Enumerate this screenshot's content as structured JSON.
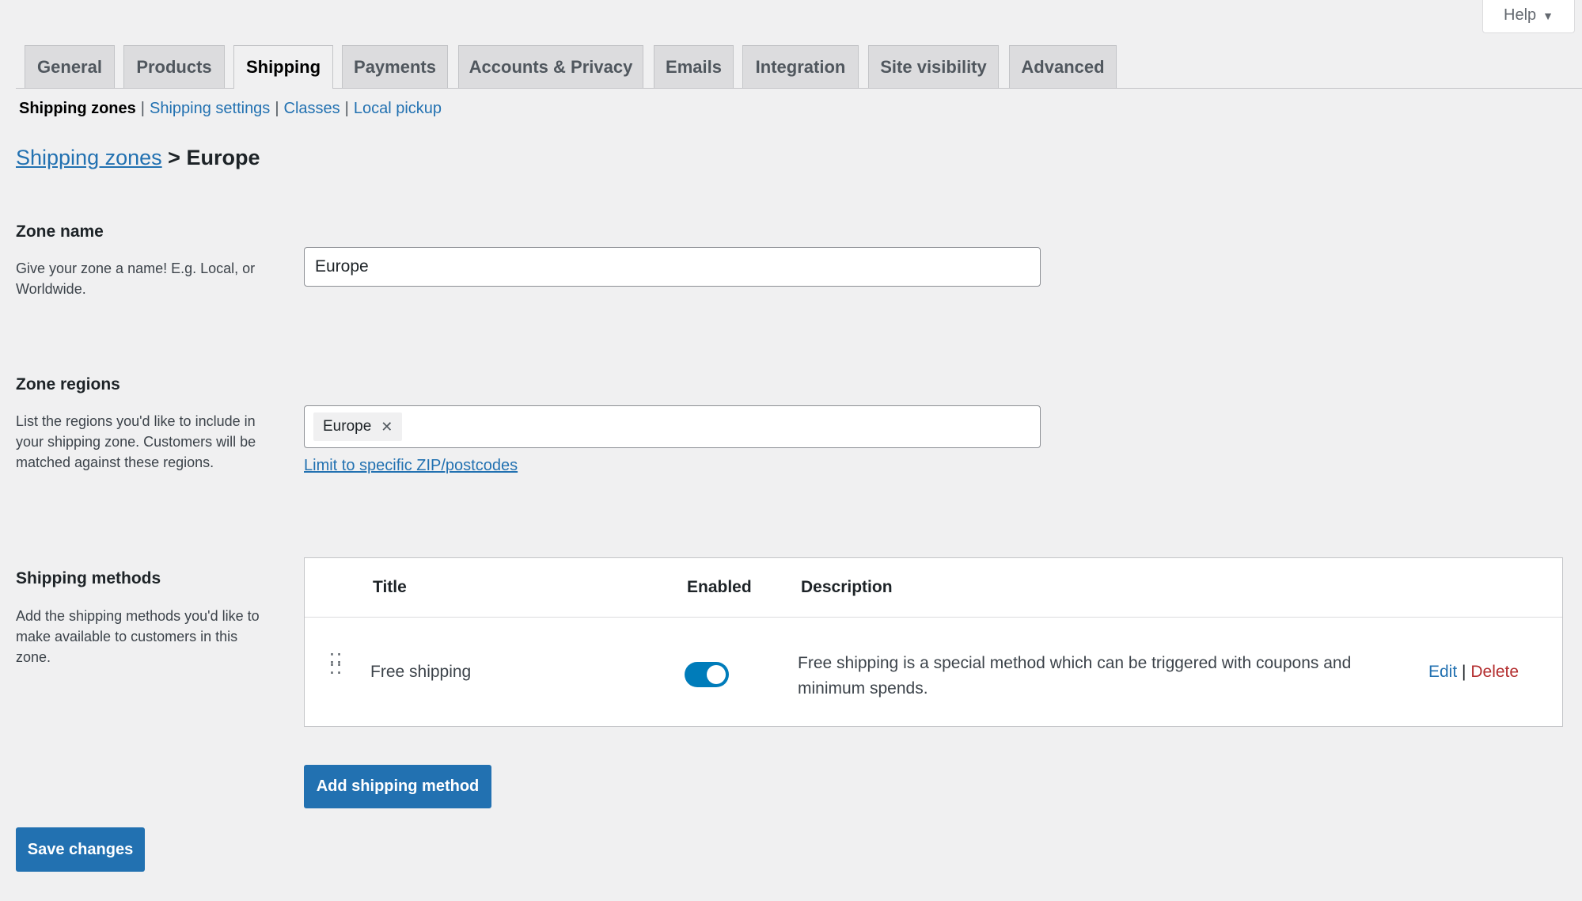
{
  "help": {
    "label": "Help"
  },
  "tabs": [
    {
      "label": "General"
    },
    {
      "label": "Products"
    },
    {
      "label": "Shipping"
    },
    {
      "label": "Payments"
    },
    {
      "label": "Accounts & Privacy"
    },
    {
      "label": "Emails"
    },
    {
      "label": "Integration"
    },
    {
      "label": "Site visibility"
    },
    {
      "label": "Advanced"
    }
  ],
  "subnav": {
    "current": "Shipping zones",
    "links": [
      "Shipping settings",
      "Classes",
      "Local pickup"
    ],
    "separator": "|"
  },
  "breadcrumb": {
    "link": "Shipping zones",
    "separator": ">",
    "current": "Europe"
  },
  "zone_name": {
    "label": "Zone name",
    "description": "Give your zone a name! E.g. Local, or Worldwide.",
    "value": "Europe"
  },
  "zone_regions": {
    "label": "Zone regions",
    "description": "List the regions you'd like to include in your shipping zone. Customers will be matched against these regions.",
    "selected": [
      "Europe"
    ],
    "limit_link": "Limit to specific ZIP/postcodes"
  },
  "shipping_methods": {
    "label": "Shipping methods",
    "description": "Add the shipping methods you'd like to make available to customers in this zone.",
    "columns": {
      "title": "Title",
      "enabled": "Enabled",
      "description": "Description"
    },
    "rows": [
      {
        "title": "Free shipping",
        "enabled": true,
        "description": "Free shipping is a special method which can be triggered with coupons and minimum spends.",
        "edit": "Edit",
        "sep": "|",
        "delete": "Delete"
      }
    ],
    "add_button": "Add shipping method"
  },
  "save_button": "Save changes",
  "colors": {
    "accent": "#2271b1",
    "toggle": "#007cba",
    "delete": "#b32d2e"
  }
}
